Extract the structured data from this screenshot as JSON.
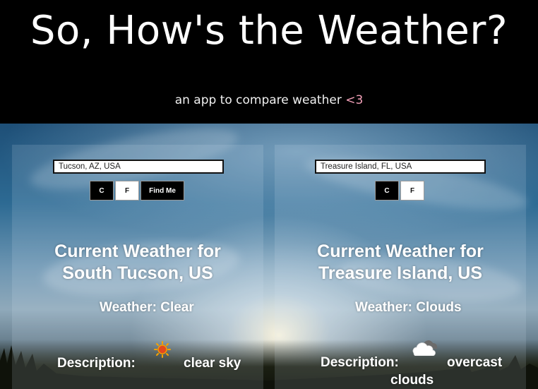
{
  "header": {
    "title": "So, How's the Weather?",
    "subtitle_text": "an app to compare weather ",
    "subtitle_heart": "<3"
  },
  "left_panel": {
    "city_input_value": "Tucson, AZ, USA",
    "celsius_label": "C",
    "fahrenheit_label": "F",
    "find_me_label": "Find Me",
    "heading_line1": "Current Weather for",
    "heading_line2": "South Tucson, US",
    "weather_line": "Weather: Clear",
    "description_label": "Description:",
    "description_value": "clear sky",
    "weather_icon": "sun-icon"
  },
  "right_panel": {
    "city_input_value": "Treasure Island, FL, USA",
    "celsius_label": "C",
    "fahrenheit_label": "F",
    "heading_line1": "Current Weather for",
    "heading_line2": "Treasure Island, US",
    "weather_line": "Weather: Clouds",
    "description_label": "Description:",
    "description_value_line1": "overcast",
    "description_value_line2": "clouds",
    "weather_icon": "cloud-icon"
  },
  "colors": {
    "header_bg": "#000000",
    "heart_accent": "#f3a0b8",
    "button_dark": "#000000",
    "button_light": "#ffffff"
  }
}
